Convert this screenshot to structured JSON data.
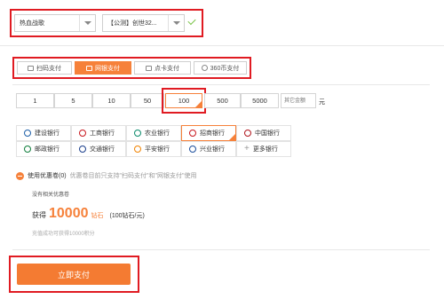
{
  "server": {
    "game_value": "热血战歌",
    "server_value": "【公测】创世32..."
  },
  "pay_tabs": [
    {
      "label": "扫码支付",
      "icon": "qr-icon"
    },
    {
      "label": "网银支付",
      "icon": "card-icon"
    },
    {
      "label": "点卡支付",
      "icon": "card-icon"
    },
    {
      "label": "360币支付",
      "icon": "coin-icon"
    }
  ],
  "active_tab": 1,
  "amounts": [
    "1",
    "5",
    "10",
    "50",
    "100",
    "500",
    "5000"
  ],
  "selected_amount": "100",
  "custom_amount_placeholder": "其它金额",
  "amount_unit": "元",
  "banks": [
    {
      "name": "建设银行",
      "icon": "ccb-icon",
      "color": "#1d5fa7"
    },
    {
      "name": "工商银行",
      "icon": "icbc-icon",
      "color": "#c8161d"
    },
    {
      "name": "农业银行",
      "icon": "abc-icon",
      "color": "#0a8a6a"
    },
    {
      "name": "招商银行",
      "icon": "cmb-icon",
      "color": "#c8161d"
    },
    {
      "name": "中国银行",
      "icon": "boc-icon",
      "color": "#b0151c"
    },
    {
      "name": "邮政银行",
      "icon": "psbc-icon",
      "color": "#0f7d3b"
    },
    {
      "name": "交通银行",
      "icon": "bocom-icon",
      "color": "#1a3e8c"
    },
    {
      "name": "平安银行",
      "icon": "pingan-icon",
      "color": "#f08300"
    },
    {
      "name": "兴业银行",
      "icon": "cib-icon",
      "color": "#1b4e9c"
    },
    {
      "name": "更多银行",
      "icon": "plus-icon",
      "color": "#999999"
    }
  ],
  "selected_bank": 3,
  "coupon": {
    "label": "使用优惠卷(0)",
    "note": "优惠卷目前只支持\"扫码支付\"和\"网银支付\"使用",
    "empty_text": "没有相关优惠卷"
  },
  "result": {
    "get_label": "获得",
    "amount": "10000",
    "currency": "钻石",
    "rate": "(100钻石/元)",
    "points_note": "充值成功可获得10000积分"
  },
  "pay_button_label": "立即支付",
  "colors": {
    "accent": "#f6813a",
    "highlight_box": "#e01b22",
    "check": "#7cc54a"
  }
}
